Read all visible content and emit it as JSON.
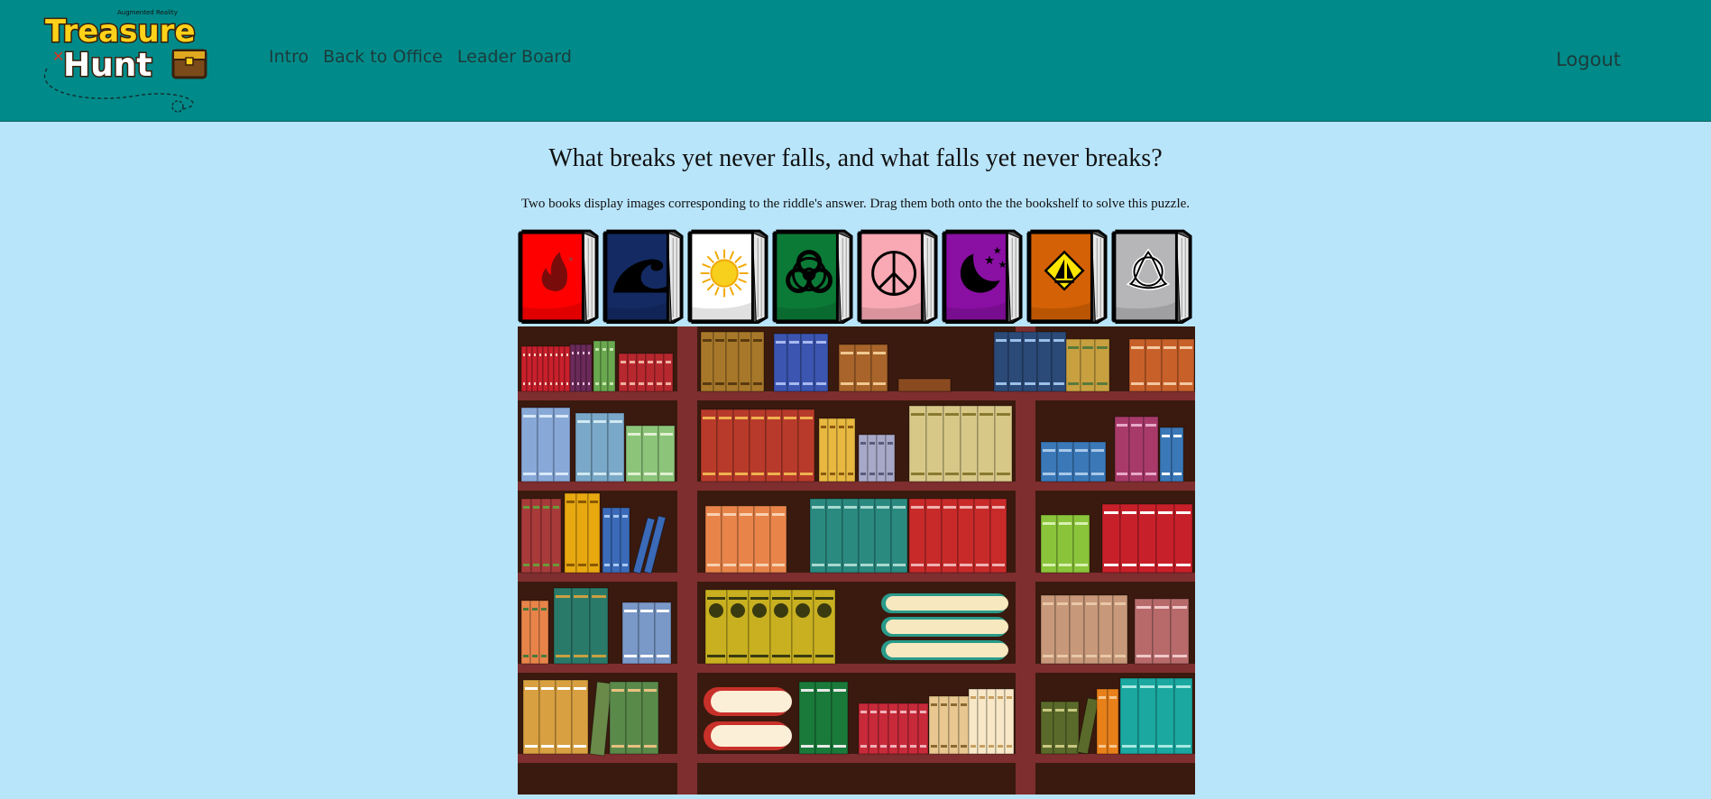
{
  "header": {
    "logo": {
      "small_text": "Augmented Reality",
      "line1": "Treasure",
      "line2": "Hunt"
    },
    "nav": [
      {
        "label": "Intro"
      },
      {
        "label": "Back to Office"
      },
      {
        "label": "Leader Board"
      }
    ],
    "logout_label": "Logout"
  },
  "puzzle": {
    "riddle": "What breaks yet never falls, and what falls yet never breaks?",
    "instructions": "Two books display images corresponding to the riddle's answer. Drag them both onto the the bookshelf to solve this puzzle."
  },
  "books": [
    {
      "icon": "flame-icon",
      "cover_color": "#ff0000"
    },
    {
      "icon": "wave-icon",
      "cover_color": "#142a63"
    },
    {
      "icon": "sun-icon",
      "cover_color": "#ffffff"
    },
    {
      "icon": "biohazard-icon",
      "cover_color": "#0b7a36"
    },
    {
      "icon": "peace-icon",
      "cover_color": "#f8a9b3"
    },
    {
      "icon": "moon-stars-icon",
      "cover_color": "#8a0fa3"
    },
    {
      "icon": "sailboat-sign-icon",
      "cover_color": "#d46105"
    },
    {
      "icon": "triquetra-icon",
      "cover_color": "#b6b6b8"
    }
  ],
  "colors": {
    "header_bg": "#008b8a",
    "page_bg": "#b9e5fb",
    "shelf_frame": "#7e2e2e",
    "shelf_back": "#3a1a0e"
  }
}
